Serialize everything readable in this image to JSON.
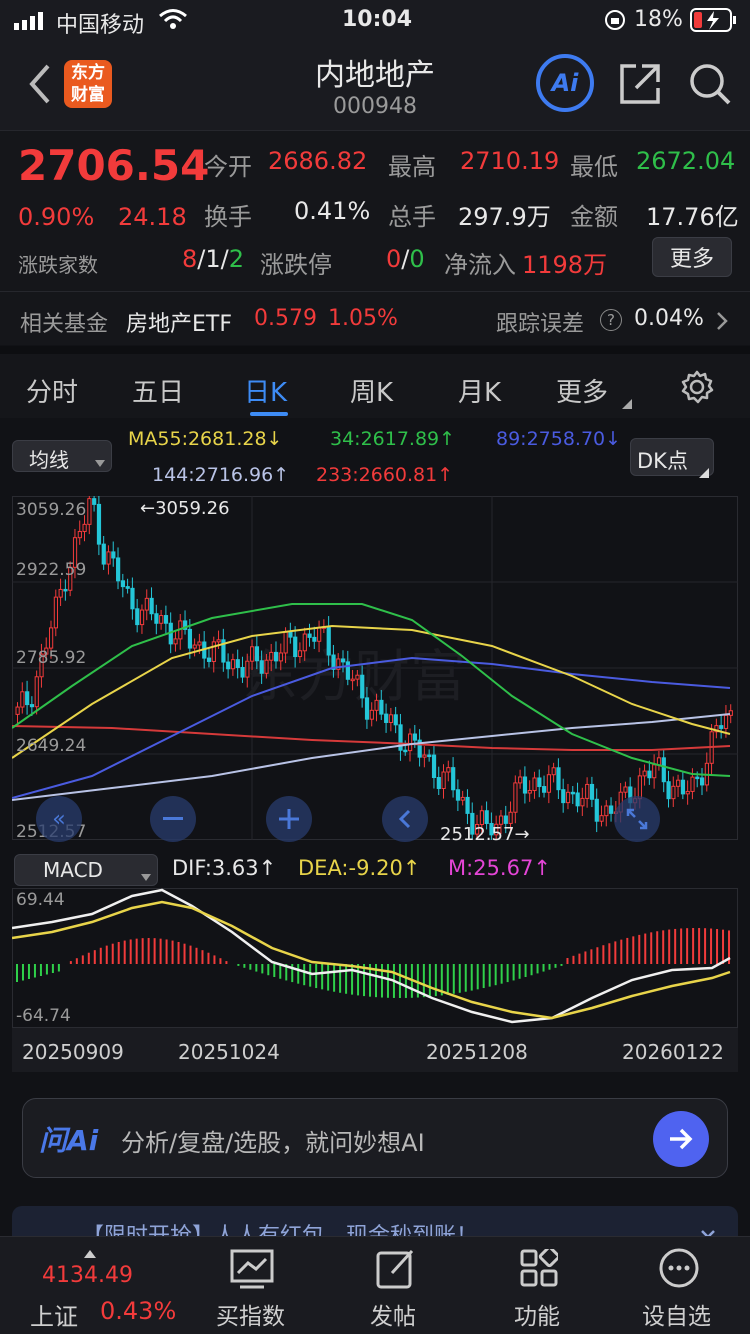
{
  "status": {
    "carrier": "中国移动",
    "time": "10:04",
    "battery": "18%"
  },
  "header": {
    "title": "内地地产",
    "code": "000948",
    "logo_line1": "东方",
    "logo_line2": "财富",
    "ai_label": "Ai"
  },
  "quote": {
    "price": "2706.54",
    "change_pct": "0.90%",
    "change": "24.18",
    "open_label": "今开",
    "open": "2686.82",
    "high_label": "最高",
    "high": "2710.19",
    "low_label": "最低",
    "low": "2672.04",
    "turnover_label": "换手",
    "turnover": "0.41%",
    "volume_label": "总手",
    "volume": "297.9万",
    "amount_label": "金额",
    "amount": "17.76亿",
    "breadth_label": "涨跌家数",
    "breadth_up": "8",
    "breadth_down": "1",
    "breadth_flat": "2",
    "slash": "/",
    "limit_label": "涨跌停",
    "limit_up": "0",
    "limit_down": "0",
    "netflow_label": "净流入",
    "netflow": "1198万",
    "more_label": "更多",
    "fund_label": "相关基金",
    "fund_name": "房地产ETF",
    "fund_price": "0.579",
    "fund_pct": "1.05%",
    "tracking_label": "跟踪误差",
    "tracking_value": "0.04%"
  },
  "tabs": [
    {
      "label": "分时"
    },
    {
      "label": "五日"
    },
    {
      "label": "日K"
    },
    {
      "label": "周K"
    },
    {
      "label": "月K"
    },
    {
      "label": "更多"
    }
  ],
  "ma": {
    "selector": "均线",
    "ma55": "MA55:2681.28",
    "ma34": "34:2617.89",
    "ma89": "89:2758.70",
    "ma144": "144:2716.96",
    "ma233": "233:2660.81",
    "dk_label": "DK点",
    "up_arrow": "↑",
    "down_arrow": "↓",
    "colors": {
      "ma55": "#e8d44a",
      "ma34": "#2fbf4a",
      "ma89": "#4a5be0",
      "ma144": "#b9c3e6",
      "ma233": "#d63a3a"
    }
  },
  "kline": {
    "y_labels": [
      "3059.26",
      "2922.59",
      "2785.92",
      "2649.24",
      "2512.57"
    ],
    "max_marker": "3059.26",
    "min_marker": "2512.57"
  },
  "macd": {
    "selector": "MACD",
    "dif": "DIF:3.63",
    "dea": "DEA:-9.20",
    "m": "M:25.67",
    "y_top": "69.44",
    "y_bottom": "-64.74"
  },
  "dates": [
    "20250909",
    "20251024",
    "20251208",
    "20260122"
  ],
  "ask": {
    "logo": "问Ai",
    "placeholder": "分析/复盘/选股，就问妙想AI"
  },
  "ticker": {
    "text": "【限时开抢】人人有红包，现金秒到账！"
  },
  "bottom": {
    "index_value": "4134.49",
    "index_name": "上证",
    "index_pct": "0.43%",
    "items": [
      {
        "label": "买指数"
      },
      {
        "label": "发帖"
      },
      {
        "label": "功能"
      },
      {
        "label": "设自选"
      }
    ]
  },
  "chart_data": {
    "type": "candlestick",
    "title": "",
    "ylim": [
      2512.57,
      3059.26
    ],
    "x_labels": [
      "20250909",
      "20251024",
      "20251208",
      "20260122"
    ],
    "close_path": [
      2710,
      2740,
      2800,
      2870,
      2950,
      3000,
      3059,
      2980,
      2940,
      2900,
      2880,
      2870,
      2860,
      2840,
      2830,
      2820,
      2810,
      2800,
      2790,
      2790,
      2800,
      2810,
      2820,
      2830,
      2840,
      2830,
      2800,
      2770,
      2740,
      2720,
      2700,
      2680,
      2660,
      2640,
      2620,
      2600,
      2570,
      2540,
      2520,
      2530,
      2560,
      2590,
      2600,
      2600,
      2590,
      2580,
      2570,
      2560,
      2550,
      2560,
      2590,
      2610,
      2620,
      2600,
      2580,
      2590,
      2640,
      2690,
      2706
    ],
    "macd": {
      "dif": 3.63,
      "dea": -9.2,
      "m": 25.67,
      "ylim": [
        -64.74,
        69.44
      ]
    }
  }
}
